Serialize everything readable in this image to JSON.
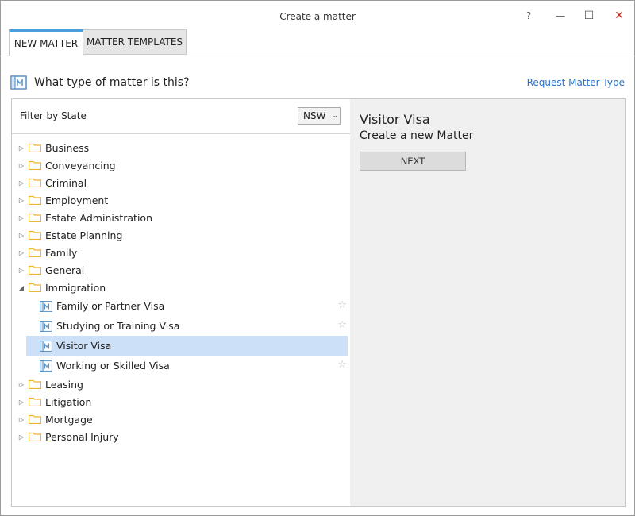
{
  "window": {
    "title": "Create a matter",
    "help": "?",
    "minimize": "—",
    "maximize": "☐",
    "close": "✕",
    "close_color": "#c42b1c"
  },
  "tabs": [
    {
      "label": "NEW MATTER",
      "active": true
    },
    {
      "label": "MATTER TEMPLATES",
      "active": false
    }
  ],
  "header": {
    "question": "What type of matter is this?",
    "request_link": "Request Matter Type",
    "icon": "matter-icon"
  },
  "filter": {
    "label": "Filter by State",
    "state": "NSW"
  },
  "tree": {
    "categories": [
      {
        "label": "Business",
        "expanded": false
      },
      {
        "label": "Conveyancing",
        "expanded": false
      },
      {
        "label": "Criminal",
        "expanded": false
      },
      {
        "label": "Employment",
        "expanded": false
      },
      {
        "label": "Estate Administration",
        "expanded": false
      },
      {
        "label": "Estate Planning",
        "expanded": false
      },
      {
        "label": "Family",
        "expanded": false
      },
      {
        "label": "General",
        "expanded": false
      },
      {
        "label": "Immigration",
        "expanded": true
      },
      {
        "label": "Leasing",
        "expanded": false
      },
      {
        "label": "Litigation",
        "expanded": false
      },
      {
        "label": "Mortgage",
        "expanded": false
      },
      {
        "label": "Personal Injury",
        "expanded": false
      }
    ],
    "immigration_children": [
      {
        "label": "Family or Partner Visa",
        "selected": false
      },
      {
        "label": "Studying or Training Visa",
        "selected": false
      },
      {
        "label": "Visitor Visa",
        "selected": true
      },
      {
        "label": "Working or Skilled Visa",
        "selected": false
      }
    ]
  },
  "detail": {
    "title": "Visitor Visa",
    "subtitle": "Create a new Matter",
    "next_label": "NEXT"
  },
  "colors": {
    "accent": "#4a9edb",
    "link": "#2a72c7",
    "selection": "#cce0f7",
    "folder": "#f2b531",
    "matter_icon": "#5a8fc4"
  }
}
